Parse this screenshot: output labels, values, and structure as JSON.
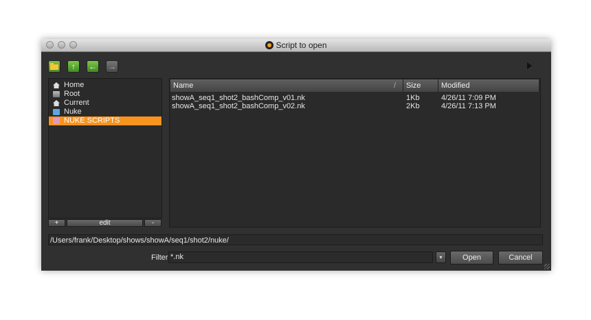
{
  "window": {
    "title": "Script to open"
  },
  "toolbar": {
    "icons": [
      "new-folder-icon",
      "up-arrow-icon",
      "back-arrow-icon",
      "forward-arrow-icon",
      "play-icon"
    ]
  },
  "favorites": {
    "items": [
      {
        "label": "Home",
        "icon": "home-icon"
      },
      {
        "label": "Root",
        "icon": "disk-icon"
      },
      {
        "label": "Current",
        "icon": "home-icon"
      },
      {
        "label": "Nuke",
        "icon": "folder-icon"
      },
      {
        "label": "NUKE SCRIPTS",
        "icon": "folder-icon",
        "selected": true
      }
    ],
    "add_label": "+",
    "edit_label": "edit",
    "more_label": "-"
  },
  "file_list": {
    "columns": {
      "name": "Name",
      "sort_indicator": "/",
      "size": "Size",
      "modified": "Modified"
    },
    "rows": [
      {
        "name": "showA_seq1_shot2_bashComp_v01.nk",
        "size": "1Kb",
        "modified": "4/26/11 7:09 PM"
      },
      {
        "name": "showA_seq1_shot2_bashComp_v02.nk",
        "size": "2Kb",
        "modified": "4/26/11 7:13 PM"
      }
    ]
  },
  "path": {
    "value": "/Users/frank/Desktop/shows/showA/seq1/shot2/nuke/"
  },
  "filter": {
    "label": "Filter:",
    "value": "*.nk",
    "dropdown_glyph": "▾"
  },
  "buttons": {
    "open": "Open",
    "cancel": "Cancel"
  },
  "colors": {
    "selection": "#f7931e",
    "window_bg": "#303030",
    "panel_bg": "#2a2a2a"
  }
}
